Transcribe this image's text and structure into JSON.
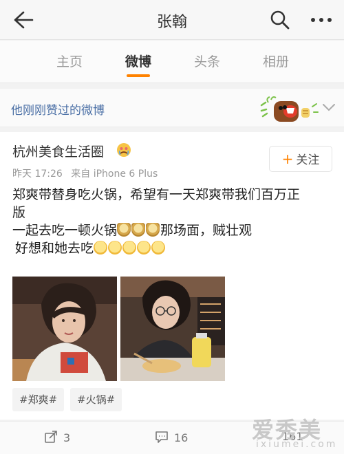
{
  "header": {
    "title": "张翰",
    "back_icon": "back-arrow-icon",
    "search_icon": "search-icon",
    "more_icon": "more-dots-icon"
  },
  "tabs": [
    {
      "label": "主页",
      "active": false
    },
    {
      "label": "微博",
      "active": true
    },
    {
      "label": "头条",
      "active": false
    },
    {
      "label": "相册",
      "active": false
    }
  ],
  "liked_section": {
    "label": "他刚刚赞过的微博",
    "chevron_icon": "chevron-down-icon"
  },
  "post": {
    "author": "杭州美食生活圈",
    "time": "昨天 17:26",
    "source": "来自 iPhone 6 Plus",
    "follow_plus": "+",
    "follow_label": "关注",
    "line1": "郑爽带替身吃火锅，希望有一天郑爽带我们百万正",
    "line2": "版",
    "line3_a": "一起去吃一顿火锅",
    "line3_b": "那场面，贼壮观",
    "line4": "好想和她去吃",
    "tags": [
      "#郑爽#",
      "#火锅#"
    ]
  },
  "actions": {
    "repost_count": "3",
    "comment_count": "16",
    "like_count": "161"
  },
  "watermark": {
    "main": "爱秀美",
    "sub": "ixiumei.com"
  },
  "colors": {
    "accent": "#ff8200",
    "link": "#4a6fa5"
  }
}
